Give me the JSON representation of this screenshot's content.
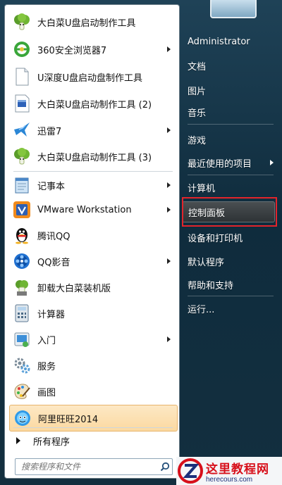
{
  "start_menu": {
    "programs": [
      {
        "label": "大白菜U盘启动制作工具",
        "icon": "cabbage-icon",
        "submenu": false
      },
      {
        "label": "360安全浏览器7",
        "icon": "360-browser-icon",
        "submenu": true
      },
      {
        "label": "U深度U盘启动盘制作工具",
        "icon": "document-icon",
        "submenu": false
      },
      {
        "label": "大白菜U盘启动制作工具 (2)",
        "icon": "app-window-icon",
        "submenu": false
      },
      {
        "label": "迅雷7",
        "icon": "thunder-icon",
        "submenu": true
      },
      {
        "label": "大白菜U盘启动制作工具 (3)",
        "icon": "cabbage-icon",
        "submenu": false
      },
      {
        "label": "记事本",
        "icon": "notepad-icon",
        "submenu": true
      },
      {
        "label": "VMware Workstation",
        "icon": "vmware-icon",
        "submenu": true
      },
      {
        "label": "腾讯QQ",
        "icon": "qq-penguin-icon",
        "submenu": false
      },
      {
        "label": "QQ影音",
        "icon": "qq-player-icon",
        "submenu": true
      },
      {
        "label": "卸载大白菜装机版",
        "icon": "uninstall-icon",
        "submenu": false
      },
      {
        "label": "计算器",
        "icon": "calculator-icon",
        "submenu": false
      },
      {
        "label": "入门",
        "icon": "getting-started-icon",
        "submenu": true
      },
      {
        "label": "服务",
        "icon": "services-icon",
        "submenu": false
      },
      {
        "label": "画图",
        "icon": "paint-icon",
        "submenu": false
      },
      {
        "label": "阿里旺旺2014",
        "icon": "aliwangwang-icon",
        "submenu": false,
        "highlighted": true
      }
    ],
    "all_programs_label": "所有程序",
    "search_placeholder": "搜索程序和文件",
    "right_items": [
      {
        "label": "Administrator",
        "submenu": false
      },
      {
        "label": "文档",
        "submenu": false
      },
      {
        "label": "图片",
        "submenu": false
      },
      {
        "label": "音乐",
        "submenu": false
      },
      {
        "label": "游戏",
        "submenu": false
      },
      {
        "label": "最近使用的项目",
        "submenu": true
      },
      {
        "label": "计算机",
        "submenu": false
      },
      {
        "label": "控制面板",
        "submenu": false,
        "highlighted": true
      },
      {
        "label": "设备和打印机",
        "submenu": false
      },
      {
        "label": "默认程序",
        "submenu": false
      },
      {
        "label": "帮助和支持",
        "submenu": false
      },
      {
        "label": "运行...",
        "submenu": false
      }
    ]
  },
  "watermark": {
    "title": "这里教程网",
    "url": "herecours.com",
    "icon": "z-logo-icon"
  },
  "colors": {
    "highlight_border": "#e2242b",
    "watermark_red": "#d7101b",
    "watermark_blue": "#1b2f7a"
  }
}
